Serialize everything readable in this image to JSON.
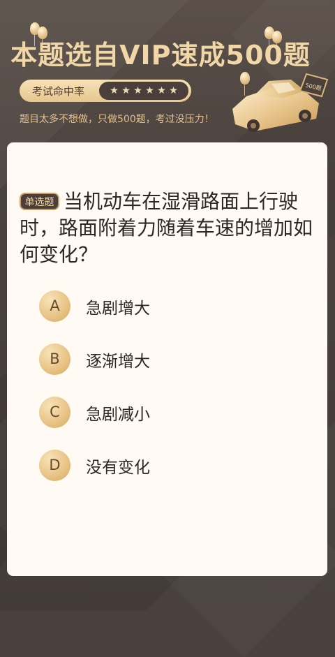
{
  "banner": {
    "title": "本题选自VIP速成500题",
    "rate_label": "考试命中率",
    "subtitle": "题目太多不想做，只做500题，考过没压力！",
    "badge": "500题"
  },
  "question": {
    "tag": "单选题",
    "text": "当机动车在湿滑路面上行驶时，路面附着力随着车速的增加如何变化？"
  },
  "options": [
    {
      "letter": "A",
      "text": "急剧增大"
    },
    {
      "letter": "B",
      "text": "逐渐增大"
    },
    {
      "letter": "C",
      "text": "急剧减小"
    },
    {
      "letter": "D",
      "text": "没有变化"
    }
  ],
  "rating": {
    "stars": 6
  },
  "colors": {
    "background": "#4a413d",
    "gold": "#e8c68f",
    "card": "#fffaf4",
    "text": "#2f2725"
  }
}
